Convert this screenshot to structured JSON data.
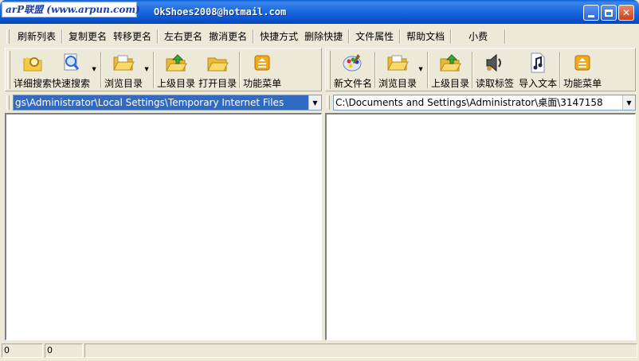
{
  "window": {
    "logo_text": "arP联盟 (www.arpun.com)",
    "title": "OkShoes2008@hotmail.com"
  },
  "menu": [
    "刷新列表",
    "复制更名",
    "转移更名",
    "左右更名",
    "撤消更名",
    "快捷方式",
    "删除快捷",
    "文件属性",
    "帮助文档",
    "小费"
  ],
  "left_pane": {
    "toolbar": [
      "详细搜索",
      "快速搜索",
      "浏览目录",
      "上级目录",
      "打开目录",
      "功能菜单"
    ],
    "path": "gs\\Administrator\\Local Settings\\Temporary Internet Files"
  },
  "right_pane": {
    "toolbar": [
      "新文件名",
      "浏览目录",
      "上级目录",
      "读取标签",
      "导入文本",
      "功能菜单"
    ],
    "path": "C:\\Documents and Settings\\Administrator\\桌面\\3147158"
  },
  "status": [
    "0",
    "0",
    ""
  ]
}
